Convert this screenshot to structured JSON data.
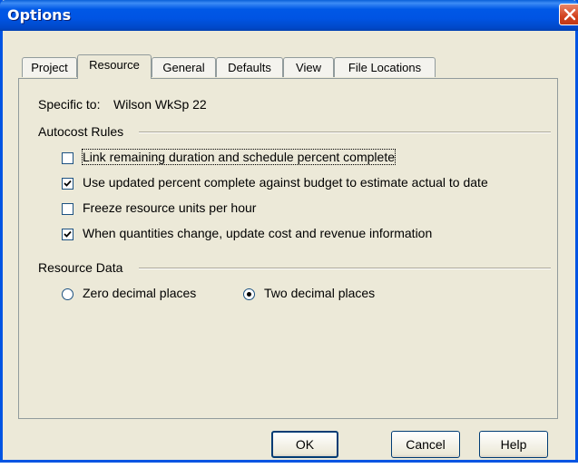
{
  "window": {
    "title": "Options"
  },
  "tabs": [
    {
      "label": "Project",
      "active": false
    },
    {
      "label": "Resource",
      "active": true
    },
    {
      "label": "General",
      "active": false
    },
    {
      "label": "Defaults",
      "active": false
    },
    {
      "label": "View",
      "active": false
    },
    {
      "label": "File Locations",
      "active": false
    }
  ],
  "resource": {
    "specific_label": "Specific to:",
    "specific_value": "Wilson WkSp 22",
    "autocost_title": "Autocost Rules",
    "options": [
      {
        "label": "Link remaining duration and schedule percent complete",
        "checked": false
      },
      {
        "label": "Use updated percent complete against budget to estimate actual to date",
        "checked": true
      },
      {
        "label": "Freeze resource units per hour",
        "checked": false
      },
      {
        "label": "When quantities change, update cost and revenue information",
        "checked": true
      }
    ],
    "data_title": "Resource Data",
    "radios": [
      {
        "label": "Zero decimal places",
        "selected": false
      },
      {
        "label": "Two decimal places",
        "selected": true
      }
    ]
  },
  "buttons": {
    "ok": "OK",
    "cancel": "Cancel",
    "help": "Help"
  },
  "colors": {
    "title_bar": "#0054e3",
    "dialog_bg": "#ece9d8",
    "close_button": "#d2421e"
  }
}
